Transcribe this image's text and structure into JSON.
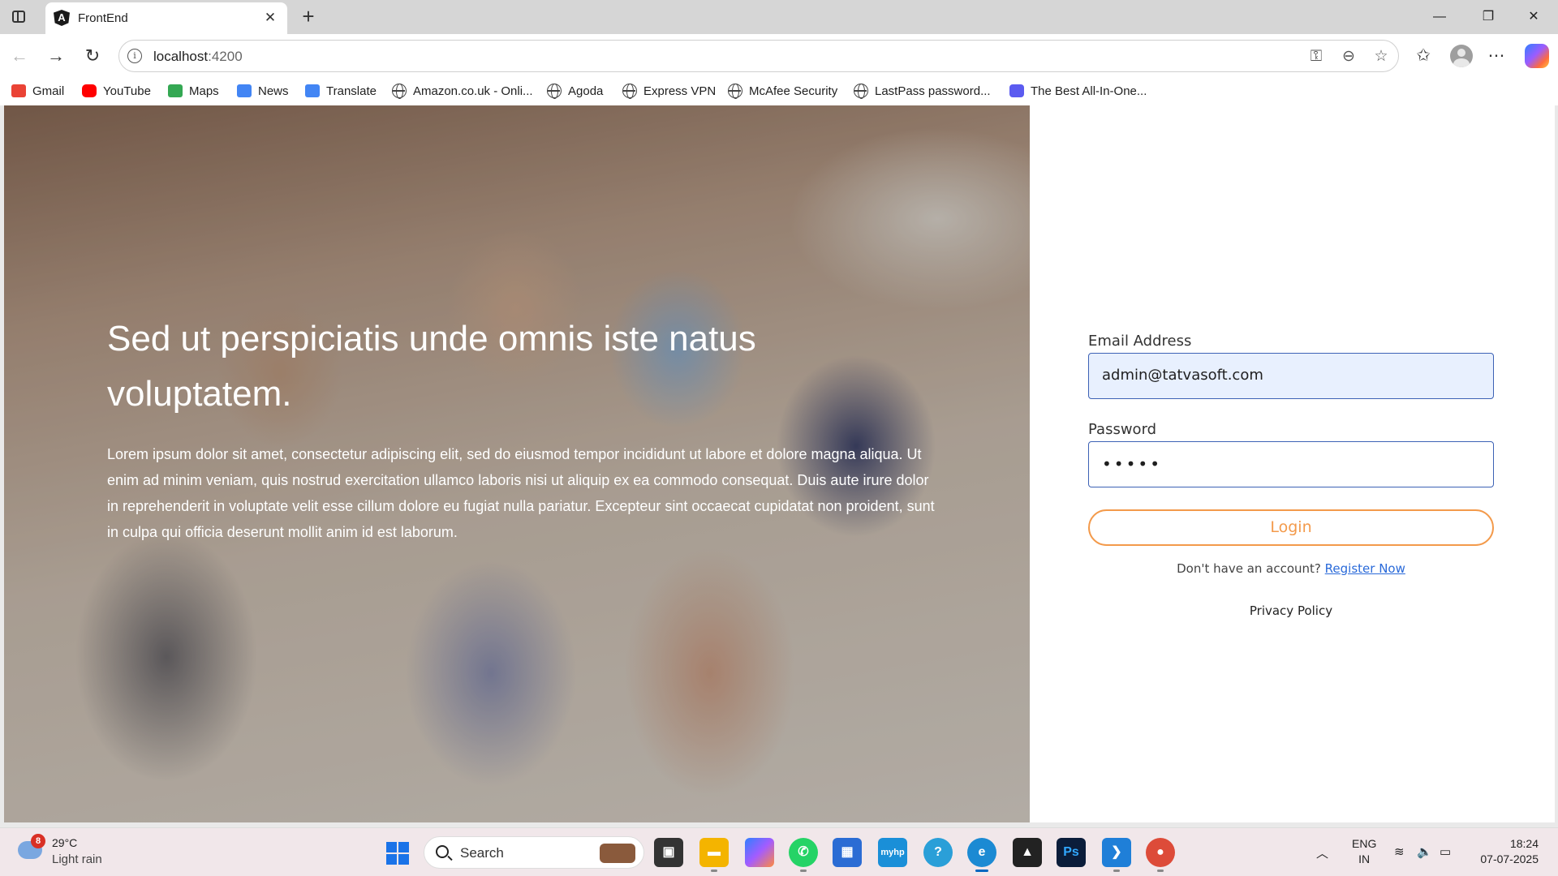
{
  "browser": {
    "tab_title": "FrontEnd",
    "url_host": "localhost",
    "url_port": ":4200",
    "tab_close_glyph": "✕",
    "new_tab_glyph": "+",
    "bookmarks": [
      {
        "label": "Gmail",
        "icon": "gmail-icon",
        "color": "#ea4335"
      },
      {
        "label": "YouTube",
        "icon": "youtube-icon",
        "color": "#ff0000"
      },
      {
        "label": "Maps",
        "icon": "maps-icon",
        "color": "#34a853"
      },
      {
        "label": "News",
        "icon": "news-icon",
        "color": "#4285f4"
      },
      {
        "label": "Translate",
        "icon": "translate-icon",
        "color": "#4285f4"
      },
      {
        "label": "Amazon.co.uk - Onli...",
        "icon": "globe-icon"
      },
      {
        "label": "Agoda",
        "icon": "globe-icon"
      },
      {
        "label": "Express VPN",
        "icon": "globe-icon"
      },
      {
        "label": "McAfee Security",
        "icon": "globe-icon"
      },
      {
        "label": "LastPass password...",
        "icon": "globe-icon"
      },
      {
        "label": "The Best All-In-One...",
        "icon": "app-icon",
        "color": "#5b5bf0"
      }
    ]
  },
  "hero": {
    "title": "Sed ut perspiciatis unde omnis iste natus voluptatem.",
    "text": "Lorem ipsum dolor sit amet, consectetur adipiscing elit, sed do eiusmod tempor incididunt ut labore et dolore magna aliqua. Ut enim ad minim veniam, quis nostrud exercitation ullamco laboris nisi ut aliquip ex ea commodo consequat. Duis aute irure dolor in reprehenderit in voluptate velit esse cillum dolore eu fugiat nulla pariatur. Excepteur sint occaecat cupidatat non proident, sunt in culpa qui officia deserunt mollit anim id est laborum."
  },
  "login": {
    "email_label": "Email Address",
    "email_value": "admin@tatvasoft.com",
    "password_label": "Password",
    "password_value": "•••••",
    "login_button": "Login",
    "register_prompt": "Don't have an account? ",
    "register_link": "Register Now",
    "privacy_link": "Privacy Policy"
  },
  "taskbar": {
    "weather_badge": "8",
    "weather_temp": "29°C",
    "weather_desc": "Light rain",
    "search_label": "Search",
    "lang_line1": "ENG",
    "lang_line2": "IN",
    "time": "18:24",
    "date": "07-07-2025",
    "apps": [
      {
        "name": "task-view-icon",
        "color": "#333333"
      },
      {
        "name": "file-explorer-icon",
        "color": "#f4b400"
      },
      {
        "name": "copilot-app-icon",
        "color": "#a35cff"
      },
      {
        "name": "whatsapp-icon",
        "color": "#25d366"
      },
      {
        "name": "microsoft-store-icon",
        "color": "#2b6cd4"
      },
      {
        "name": "myhp-icon",
        "color": "#1a8fd8"
      },
      {
        "name": "help-icon",
        "color": "#2a9fd8"
      },
      {
        "name": "edge-icon",
        "color": "#1b8ad3"
      },
      {
        "name": "affinity-icon",
        "color": "#222222"
      },
      {
        "name": "photoshop-icon",
        "color": "#0b1d3a"
      },
      {
        "name": "vscode-icon",
        "color": "#1f7fd8"
      },
      {
        "name": "chrome-icon",
        "color": "#dd4b39"
      }
    ]
  }
}
